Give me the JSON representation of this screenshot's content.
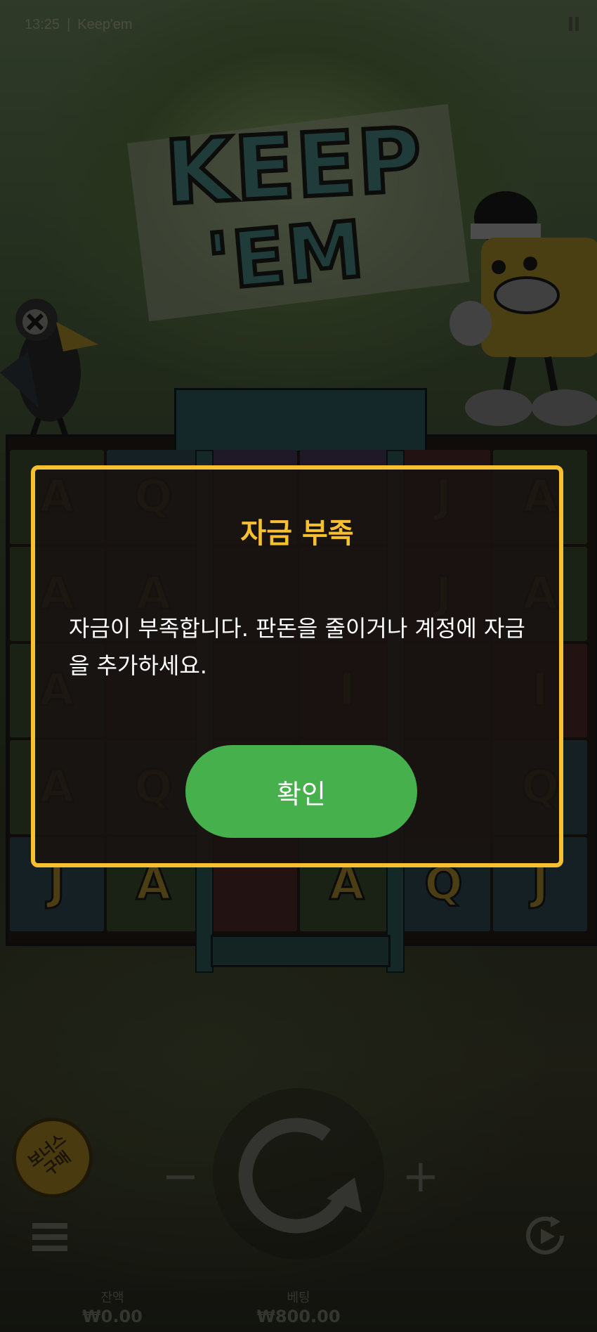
{
  "status_bar": {
    "time": "13:25",
    "separator": "|",
    "app_name": "Keep'em"
  },
  "logo": {
    "line1": "KEEP",
    "line2": "'EM"
  },
  "reels": [
    [
      "A",
      "Q",
      "",
      "",
      "J",
      "A"
    ],
    [
      "A",
      "A",
      "",
      "",
      "J",
      "A"
    ],
    [
      "A",
      "",
      "",
      "I",
      "",
      "I"
    ],
    [
      "A",
      "Q",
      "",
      "",
      "",
      "Q"
    ],
    [
      "J",
      "A",
      "",
      "A",
      "Q",
      "J"
    ]
  ],
  "controls": {
    "bonus_buy_label": "보너스 구매",
    "minus_label": "−",
    "plus_label": "+",
    "balance_label": "잔액",
    "balance_value": "₩0.00",
    "bet_label": "베팅",
    "bet_value": "₩800.00"
  },
  "dialog": {
    "title": "자금 부족",
    "message": "자금이 부족합니다. 판돈을 줄이거나 계정에 자금을 추가하세요.",
    "confirm_label": "확인"
  },
  "colors": {
    "dialog_border": "#f7c030",
    "title": "#f7c030",
    "confirm_button": "#45b04c"
  }
}
